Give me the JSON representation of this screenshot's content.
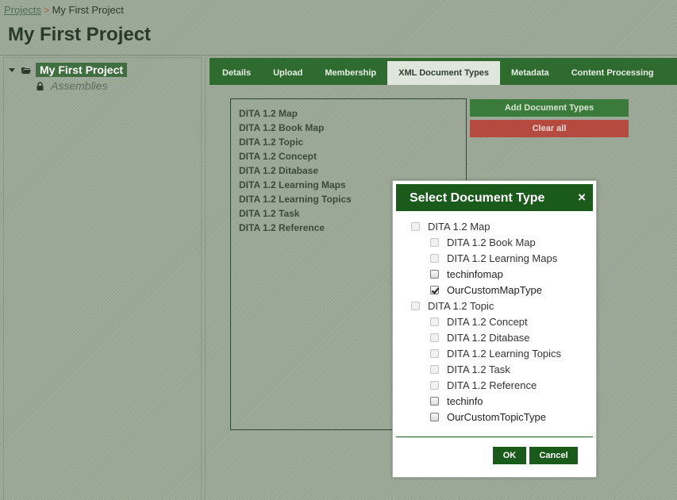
{
  "breadcrumb": {
    "projects_link": "Projects",
    "separator": ">",
    "current": "My First Project"
  },
  "page_title": "My First Project",
  "tree": {
    "root_label": "My First Project",
    "root_icon": "folder-open-icon",
    "children": [
      {
        "label": "Assemblies",
        "icon": "lock-icon"
      }
    ]
  },
  "tabs": [
    {
      "label": "Details",
      "active": false
    },
    {
      "label": "Upload",
      "active": false
    },
    {
      "label": "Membership",
      "active": false
    },
    {
      "label": "XML Document Types",
      "active": true
    },
    {
      "label": "Metadata",
      "active": false
    },
    {
      "label": "Content Processing",
      "active": false
    }
  ],
  "document_types": [
    "DITA 1.2 Map",
    "DITA 1.2 Book Map",
    "DITA 1.2 Topic",
    "DITA 1.2 Concept",
    "DITA 1.2 Ditabase",
    "DITA 1.2 Learning Maps",
    "DITA 1.2 Learning Topics",
    "DITA 1.2 Task",
    "DITA 1.2 Reference"
  ],
  "actions": {
    "add_label": "Add Document Types",
    "clear_label": "Clear all"
  },
  "dialog": {
    "title": "Select Document Type",
    "close_glyph": "×",
    "ok_label": "OK",
    "cancel_label": "Cancel",
    "options": [
      {
        "label": "DITA 1.2 Map",
        "level": 0,
        "checked": false,
        "disabled": true
      },
      {
        "label": "DITA 1.2 Book Map",
        "level": 1,
        "checked": false,
        "disabled": true
      },
      {
        "label": "DITA 1.2 Learning Maps",
        "level": 1,
        "checked": false,
        "disabled": true
      },
      {
        "label": "techinfomap",
        "level": 1,
        "checked": false,
        "disabled": false
      },
      {
        "label": "OurCustomMapType",
        "level": 1,
        "checked": true,
        "disabled": false
      },
      {
        "label": "DITA 1.2 Topic",
        "level": 0,
        "checked": false,
        "disabled": true
      },
      {
        "label": "DITA 1.2 Concept",
        "level": 1,
        "checked": false,
        "disabled": true
      },
      {
        "label": "DITA 1.2 Ditabase",
        "level": 1,
        "checked": false,
        "disabled": true
      },
      {
        "label": "DITA 1.2 Learning Topics",
        "level": 1,
        "checked": false,
        "disabled": true
      },
      {
        "label": "DITA 1.2 Task",
        "level": 1,
        "checked": false,
        "disabled": true
      },
      {
        "label": "DITA 1.2 Reference",
        "level": 1,
        "checked": false,
        "disabled": true
      },
      {
        "label": "techinfo",
        "level": 1,
        "checked": false,
        "disabled": false
      },
      {
        "label": "OurCustomTopicType",
        "level": 1,
        "checked": false,
        "disabled": false
      }
    ]
  },
  "colors": {
    "primary_green": "#1a5a1a",
    "tab_bar_green": "#2f6a2f",
    "add_button_green": "#3a7a3a",
    "clear_button_red": "#b54a40",
    "page_background": "#98a593"
  }
}
